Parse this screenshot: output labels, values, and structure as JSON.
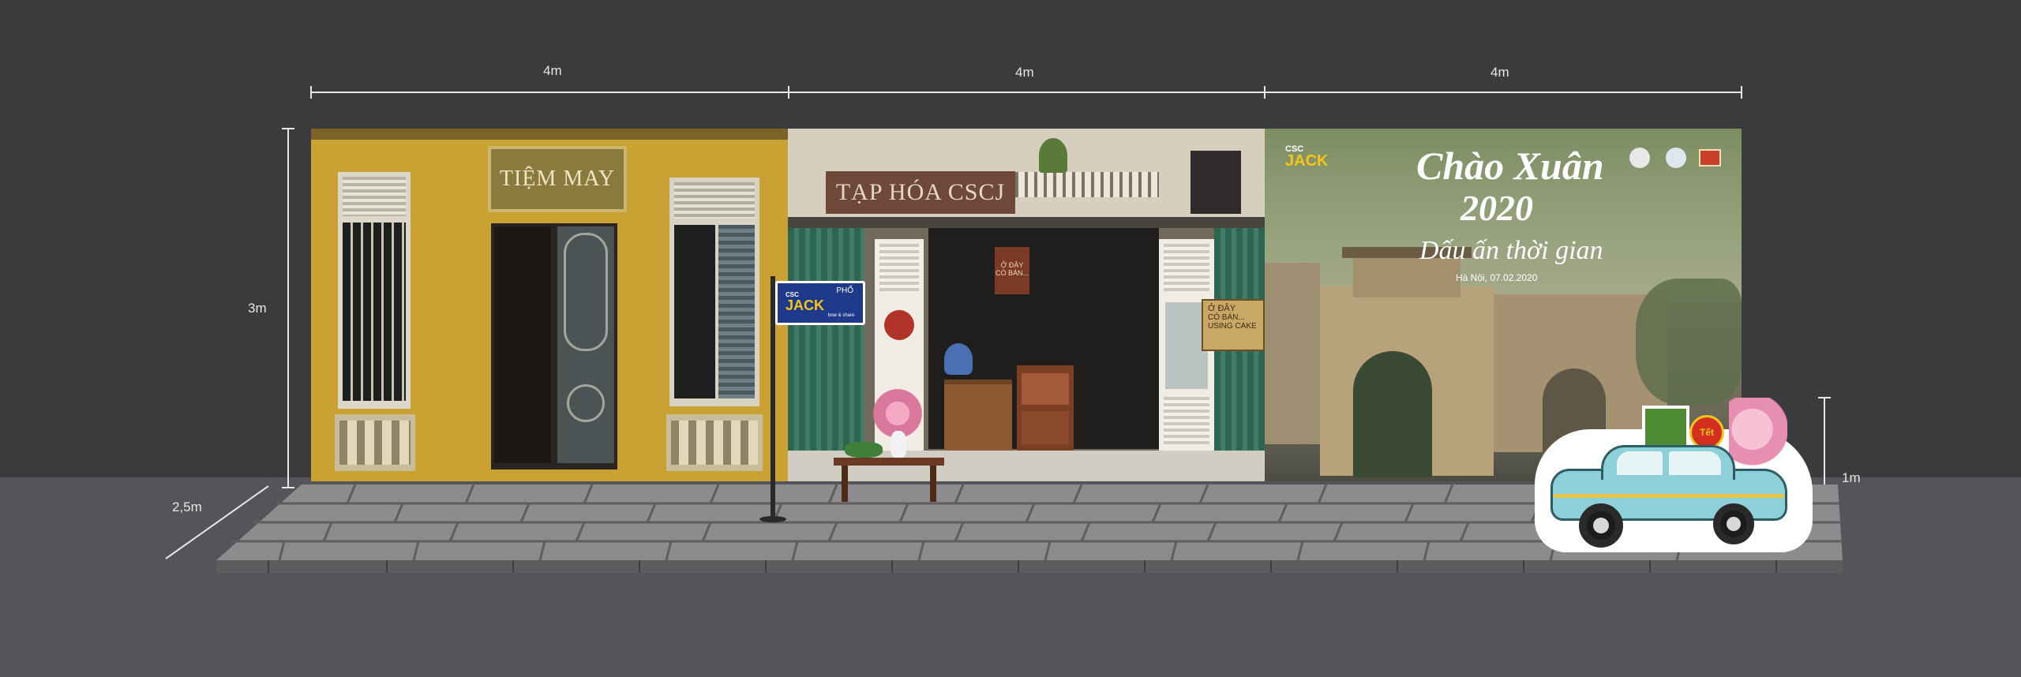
{
  "dimensions": {
    "width_labels": [
      "4m",
      "4m",
      "4m"
    ],
    "height_label": "3m",
    "depth_label": "2,5m",
    "standee_height_label": "1m"
  },
  "shop_tailor": {
    "sign": "TIỆM MAY"
  },
  "shop_grocery": {
    "sign": "TẠP HÓA CSCJ",
    "street_sign": {
      "street_word": "PHỐ",
      "brand_top": "CSC",
      "brand_name": "JACK",
      "brand_tag": "bow & share"
    },
    "hanging_note": "Ở ĐÂY CÓ BÁN...",
    "side_board": {
      "line1": "Ở ĐÂY",
      "line2": "CÓ BÁN...",
      "line3": "USING CAKE"
    }
  },
  "banner": {
    "brand_top": "CSC",
    "brand_name": "JACK",
    "title_line1": "Chào Xuân",
    "title_line2": "2020",
    "subtitle": "Dấu ấn thời gian",
    "date": "Hà Nội, 07.02.2020"
  },
  "car_standee": {
    "badge": "Tết"
  }
}
